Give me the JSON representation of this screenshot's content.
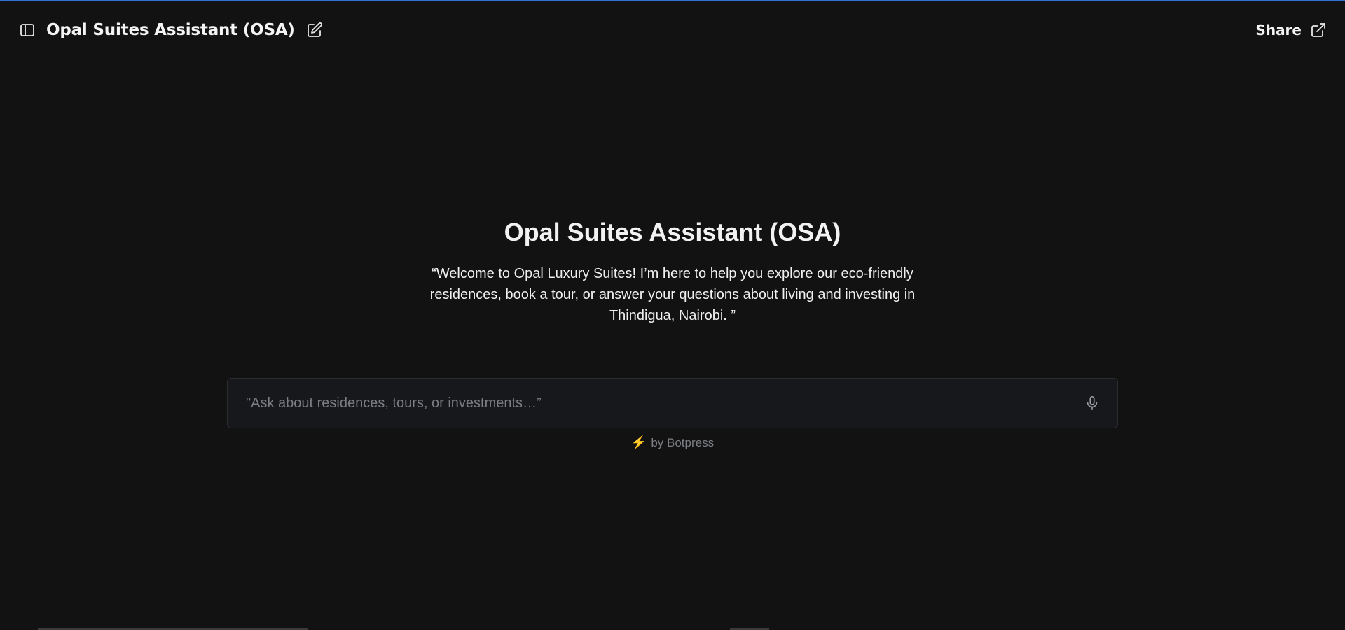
{
  "header": {
    "title": "Opal Suites Assistant (OSA)",
    "share_label": "Share",
    "icons": {
      "sidebar_toggle": "sidebar-toggle-icon",
      "edit": "edit-icon",
      "share": "external-link-icon"
    }
  },
  "hero": {
    "title": "Opal Suites Assistant (OSA)",
    "subtitle": "“Welcome to Opal Luxury Suites! I’m here to help you explore our eco-friendly residences, book a tour, or answer your questions about living and investing in Thindigua, Nairobi. ”"
  },
  "composer": {
    "placeholder": "\"Ask about residences, tours, or investments…”",
    "value": "",
    "mic_icon": "microphone-icon"
  },
  "footer": {
    "powered_by": "by Botpress",
    "bolt_icon": "lightning-bolt-icon"
  },
  "colors": {
    "background": "#121212",
    "accent_line": "#2f6fd6",
    "input_bg": "#17181b",
    "bolt": "#f5c518"
  }
}
